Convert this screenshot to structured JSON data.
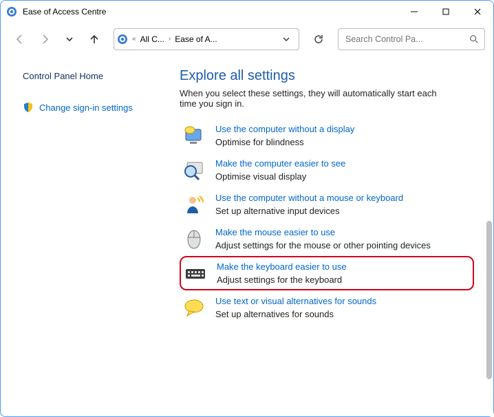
{
  "window": {
    "title": "Ease of Access Centre"
  },
  "toolbar": {
    "breadcrumb": {
      "item1": "All C...",
      "item2": "Ease of A..."
    },
    "search_placeholder": "Search Control Pa..."
  },
  "sidebar": {
    "home": "Control Panel Home",
    "signin": "Change sign-in settings"
  },
  "page": {
    "title": "Explore all settings",
    "subtitle": "When you select these settings, they will automatically start each time you sign in."
  },
  "options": [
    {
      "title": "Use the computer without a display",
      "desc": "Optimise for blindness"
    },
    {
      "title": "Make the computer easier to see",
      "desc": "Optimise visual display"
    },
    {
      "title": "Use the computer without a mouse or keyboard",
      "desc": "Set up alternative input devices"
    },
    {
      "title": "Make the mouse easier to use",
      "desc": "Adjust settings for the mouse or other pointing devices"
    },
    {
      "title": "Make the keyboard easier to use",
      "desc": "Adjust settings for the keyboard"
    },
    {
      "title": "Use text or visual alternatives for sounds",
      "desc": "Set up alternatives for sounds"
    }
  ]
}
